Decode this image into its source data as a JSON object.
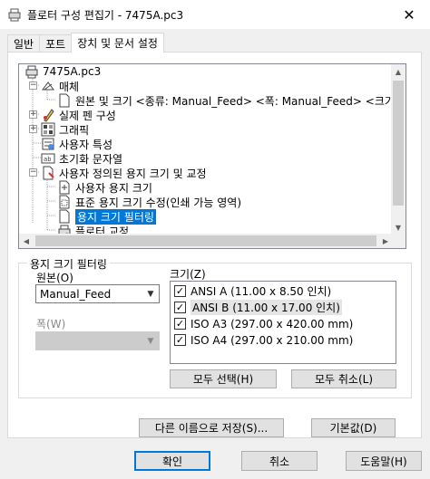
{
  "window": {
    "title": "플로터 구성 편집기 - 7475A.pc3",
    "close_glyph": "✕"
  },
  "tabs": [
    {
      "label": "일반",
      "active": false
    },
    {
      "label": "포트",
      "active": false
    },
    {
      "label": "장치 및 문서 설정",
      "active": true
    }
  ],
  "tree": {
    "items": [
      {
        "label": "7475A.pc3",
        "icon": "plotter-icon",
        "expander": ""
      },
      {
        "label": "매체",
        "icon": "media-icon",
        "expander": "−"
      },
      {
        "label": "원본 및 크기 <종류: Manual_Feed> <폭: Manual_Feed> <크기:",
        "icon": "page-icon",
        "expander": ""
      },
      {
        "label": "실제 펜 구성",
        "icon": "pen-icon",
        "expander": "+"
      },
      {
        "label": "그래픽",
        "icon": "graphics-icon",
        "expander": "+"
      },
      {
        "label": "사용자 특성",
        "icon": "properties-icon",
        "expander": ""
      },
      {
        "label": "초기화 문자열",
        "icon": "init-string-icon",
        "expander": ""
      },
      {
        "label": "사용자 정의된 용지 크기 및 교정",
        "icon": "custom-paper-icon",
        "expander": "−"
      },
      {
        "label": "사용자 용지 크기",
        "icon": "paper-size-icon",
        "expander": ""
      },
      {
        "label": "표준 용지 크기 수정(인쇄 가능 영역)",
        "icon": "modify-paper-icon",
        "expander": ""
      },
      {
        "label": "용지 크기 필터링",
        "icon": "filter-icon",
        "expander": "",
        "selected": true
      },
      {
        "label": "플로터 교정",
        "icon": "calibration-icon",
        "expander": ""
      }
    ]
  },
  "filter_group": {
    "title": "용지 크기 필터링",
    "source_label": "원본(O)",
    "source_value": "Manual_Feed",
    "width_label": "폭(W)",
    "width_value": "",
    "size_label": "크기(Z)",
    "sizes": [
      {
        "label": "ANSI A (11.00 x 8.50 인치)",
        "checked": true
      },
      {
        "label": "ANSI B (11.00 x 17.00 인치)",
        "checked": true
      },
      {
        "label": "ISO A3 (297.00 x 420.00 mm)",
        "checked": true
      },
      {
        "label": "ISO A4 (297.00 x 210.00 mm)",
        "checked": true
      }
    ],
    "select_all": "모두 선택(H)",
    "clear_all": "모두 취소(L)"
  },
  "panel_buttons": {
    "save_as": "다른 이름으로 저장(S)...",
    "defaults": "기본값(D)"
  },
  "dialog_buttons": {
    "ok": "확인",
    "cancel": "취소",
    "help": "도움말(H)"
  }
}
